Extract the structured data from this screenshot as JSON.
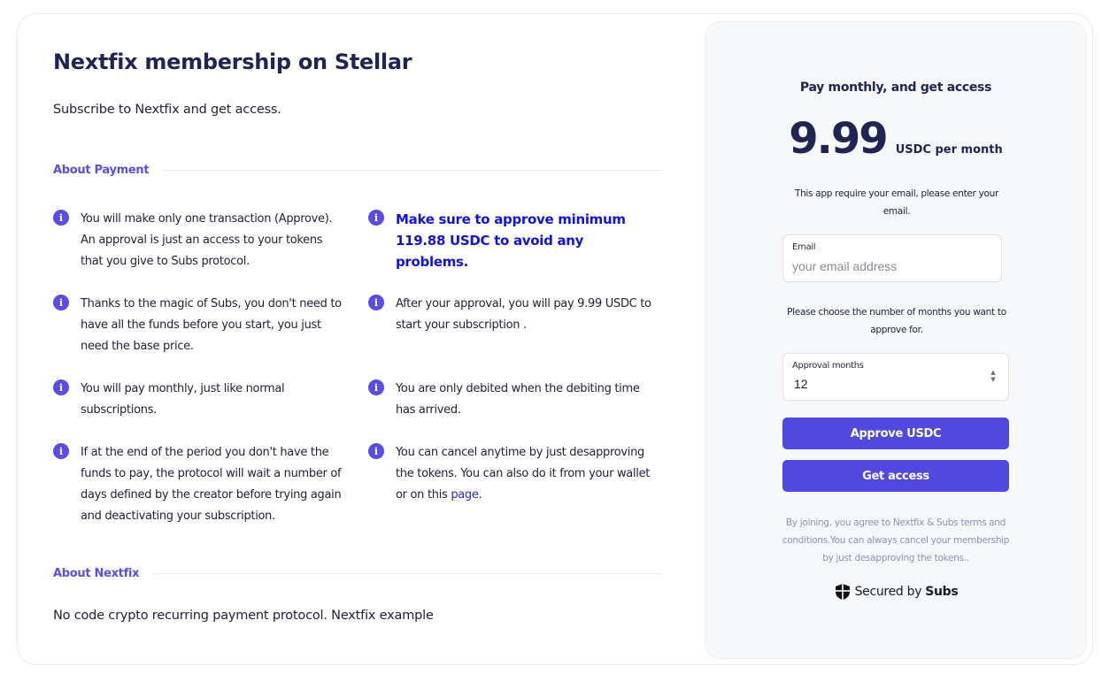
{
  "main": {
    "title": "Nextfix membership on Stellar",
    "subtitle": "Subscribe to Nextfix and get access.",
    "about_payment_heading": "About Payment",
    "info_icon": "info-icon",
    "left_items": [
      "You will make only one transaction (Approve). An approval is just an access to your tokens that you give to Subs protocol.",
      "Thanks to the magic of Subs, you don't need to have all the funds before you start, you just need the base price.",
      "You will pay monthly, just like normal subscriptions.",
      "If at the end of the period you don't have the funds to pay, the protocol will wait a number of days defined by the creator before trying again and deactivating your subscription."
    ],
    "right_items": [
      "Make sure to approve minimum 119.88 USDC to avoid any problems.",
      "After your approval, you will pay 9.99 USDC to start your subscription .",
      "You are only debited when the debiting time has arrived.",
      "You can cancel anytime by just desapproving the tokens. You can also do it from your wallet or on this "
    ],
    "cancel_link_text": "page.",
    "about_nextfix_heading": "About Nextfix",
    "about_nextfix_text": "No code crypto recurring payment protocol. Nextfix example"
  },
  "panel": {
    "heading": "Pay monthly, and get access",
    "price": "9.99",
    "price_unit": "USDC per month",
    "email_note": "This app require your email, please enter your email.",
    "email_label": "Email",
    "email_placeholder": "your email address",
    "email_value": "",
    "months_note": "Please choose the number of months you want to approve for.",
    "months_label": "Approval months",
    "months_value": "12",
    "approve_button": "Approve USDC",
    "access_button": "Get access",
    "legal": "By joining, you agree to Nextfix & Subs terms and conditions.You can always cancel your membership by just desapproving the tokens..",
    "secured_prefix": "Secured by",
    "secured_brand": "Subs",
    "shield_icon": "shield-icon"
  },
  "colors": {
    "accent": "#5148e0",
    "title": "#1f2452",
    "warning_text": "#1313d6",
    "legal_text": "#8c92b3"
  }
}
